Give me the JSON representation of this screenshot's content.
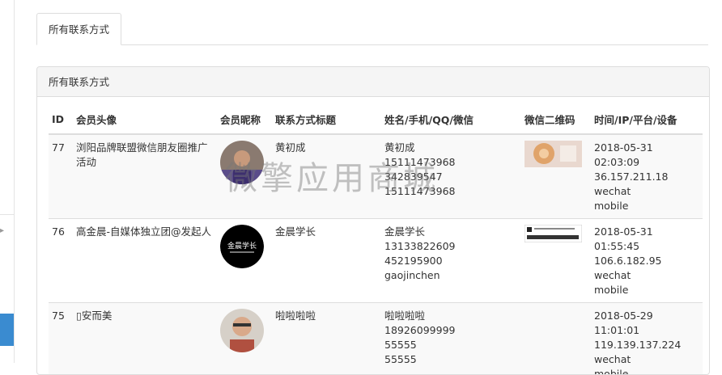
{
  "tabs": [
    {
      "label": "所有联系方式"
    }
  ],
  "panel": {
    "title": "所有联系方式"
  },
  "table": {
    "headers": [
      "ID",
      "会员头像",
      "会员昵称",
      "联系方式标题",
      "姓名/手机/QQ/微信",
      "微信二维码",
      "时间/IP/平台/设备"
    ],
    "rows": [
      {
        "id": "77",
        "title": "浏阳品牌联盟微信朋友圈推广活动",
        "nickname": "黄初成",
        "name": "黄初成",
        "phone": "15111473968",
        "qq": "342839547",
        "wechat": "15111473968",
        "time": "2018-05-31",
        "clock": "02:03:09",
        "ip": "36.157.211.18",
        "platform": "wechat",
        "device": "mobile"
      },
      {
        "id": "76",
        "title": "高金晨-自媒体独立团@发起人",
        "nickname": "金晨学长",
        "avatar_text": "金晨学长",
        "name": "金晨学长",
        "phone": "13133822609",
        "qq": "452195900",
        "wechat": "gaojinchen",
        "time": "2018-05-31",
        "clock": "01:55:45",
        "ip": "106.6.182.95",
        "platform": "wechat",
        "device": "mobile"
      },
      {
        "id": "75",
        "title": "安而美",
        "nickname": "啦啦啦啦",
        "name": "啦啦啦啦",
        "phone": "18926099999",
        "qq": "55555",
        "wechat": "55555",
        "time": "2018-05-29",
        "clock": "11:01:01",
        "ip": "119.139.137.224",
        "platform": "wechat",
        "device": "mobile"
      }
    ]
  },
  "watermark": "微擎应用商城",
  "colors": {
    "accent": "#3a8bd0",
    "border": "#dddddd",
    "panel_head": "#f5f5f5"
  }
}
